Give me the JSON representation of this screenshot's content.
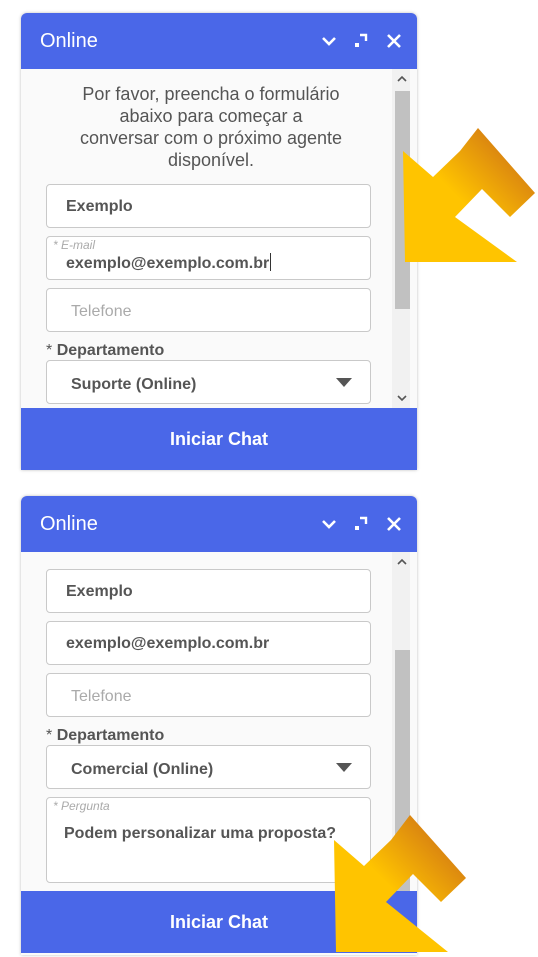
{
  "panel1": {
    "header": {
      "title": "Online"
    },
    "intro": [
      "Por favor, preencha o formulário",
      "abaixo para começar a",
      "conversar com o próximo agente",
      "disponível."
    ],
    "name_value": "Exemplo",
    "email_label": "* E-mail",
    "email_value": "exemplo@exemplo.com.br",
    "phone_placeholder": "Telefone",
    "dept_asterisk": "*",
    "dept_label": "Departamento",
    "dept_value": "Suporte (Online)",
    "start_button": "Iniciar Chat"
  },
  "panel2": {
    "header": {
      "title": "Online"
    },
    "name_value": "Exemplo",
    "email_value": "exemplo@exemplo.com.br",
    "phone_placeholder": "Telefone",
    "dept_asterisk": "*",
    "dept_label": "Departamento",
    "dept_value": "Comercial (Online)",
    "question_label": "* Pergunta",
    "question_value": "Podem personalizar uma proposta?",
    "start_button": "Iniciar Chat"
  },
  "icons": [
    "chevron-down-icon",
    "popout-icon",
    "close-icon",
    "scroll-up-icon",
    "scroll-down-icon",
    "pointer-arrow-icon"
  ],
  "colors": {
    "header": "#4a67e8",
    "button": "#4a67e8",
    "arrow_start": "#c4601a",
    "arrow_end": "#ffc400"
  }
}
